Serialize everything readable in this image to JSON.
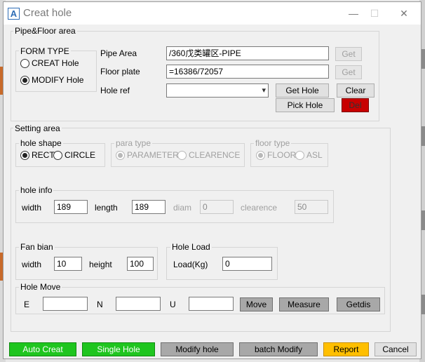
{
  "window": {
    "title": "Creat hole",
    "icon_letter": "A",
    "icon": "app-logo-icon",
    "minimize": "—",
    "maximize": "☐",
    "close": "✕"
  },
  "pipe_floor": {
    "label": "Pipe&Floor area",
    "form_type": {
      "label": "FORM TYPE",
      "options": [
        "CREAT  Hole",
        "MODIFY Hole"
      ],
      "selected": 1
    },
    "pipe_area": {
      "label": "Pipe   Area",
      "value": "/360戊类罐区-PIPE",
      "get": "Get"
    },
    "floor_plate": {
      "label": "Floor plate",
      "value": "=16386/72057",
      "get": "Get"
    },
    "hole_ref": {
      "label": "Hole  ref",
      "value": ""
    },
    "get_hole": "Get Hole",
    "clear": "Clear",
    "pick_hole": "Pick Hole",
    "del": "Del"
  },
  "setting": {
    "label": "Setting area",
    "hole_shape": {
      "label": "hole shape",
      "options": [
        "RECT",
        "CIRCLE"
      ],
      "selected": 0
    },
    "para_type": {
      "label": "para type",
      "options": [
        "PARAMETER",
        "CLEARENCE"
      ],
      "selected": 0
    },
    "floor_type": {
      "label": "floor type",
      "options": [
        "FLOOR",
        "ASL"
      ],
      "selected": 0
    },
    "hole_info": {
      "label": "hole info",
      "width_label": "width",
      "width": "189",
      "length_label": "length",
      "length": "189",
      "diam_label": "diam",
      "diam": "0",
      "clearence_label": "clearence",
      "clearence": "50"
    },
    "fan_bian": {
      "label": "Fan bian",
      "width_label": "width",
      "width": "10",
      "height_label": "height",
      "height": "100"
    },
    "hole_load": {
      "label": "Hole Load",
      "load_label": "Load(Kg)",
      "load": "0"
    },
    "hole_move": {
      "label": "Hole Move",
      "e_label": "E",
      "e": "",
      "n_label": "N",
      "n": "",
      "u_label": "U",
      "u": "",
      "move": "Move",
      "measure": "Measure",
      "getdis": "Getdis"
    }
  },
  "footer": {
    "auto_creat": "Auto Creat",
    "single_hole": "Single Hole",
    "modify_hole": "Modify hole",
    "batch_modify": "batch Modify",
    "report": "Report",
    "cancel": "Cancel"
  },
  "colors": {
    "green": "#1fc51f",
    "red": "#c80000",
    "yellow": "#ffbf00",
    "dark": "#a8a8a8",
    "accent": "#2d6cb5"
  }
}
